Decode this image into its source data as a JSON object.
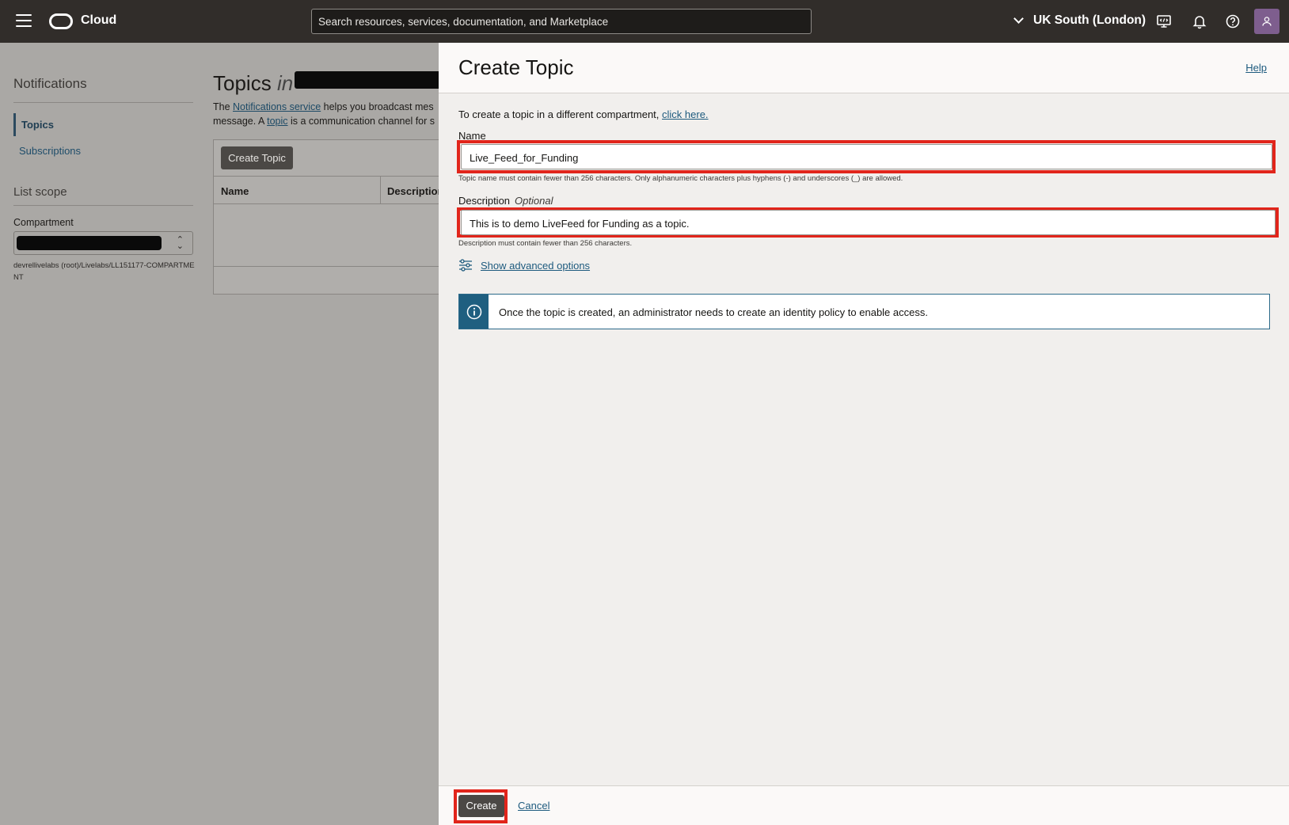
{
  "topbar": {
    "brand": "Cloud",
    "search_placeholder": "Search resources, services, documentation, and Marketplace",
    "region": "UK South (London)"
  },
  "background": {
    "nav_title": "Notifications",
    "nav_items": [
      "Topics",
      "Subscriptions"
    ],
    "scope_title": "List scope",
    "compartment_label": "Compartment",
    "compartment_path": "devrellivelabs (root)/Livelabs/LL151177-COMPARTMENT",
    "page_title_prefix": "Topics",
    "page_title_in": "in",
    "desc_line1_pre": "The ",
    "desc_link1": "Notifications service",
    "desc_line1_post": " helps you broadcast mes",
    "desc_line2_pre": "message. A ",
    "desc_link2": "topic",
    "desc_line2_post": " is a communication channel for s",
    "create_button": "Create Topic",
    "col_name": "Name",
    "col_description": "Description"
  },
  "drawer": {
    "title": "Create Topic",
    "help": "Help",
    "intro": "To create a topic in a different compartment, ",
    "intro_link": "click here.",
    "name_label": "Name",
    "name_value": "Live_Feed_for_Funding",
    "name_hint": "Topic name must contain fewer than 256 characters. Only alphanumeric characters plus hyphens (-) and underscores (_) are allowed.",
    "desc_label": "Description",
    "desc_optional": "Optional",
    "desc_value": "This is to demo LiveFeed for Funding as a topic.",
    "desc_hint": "Description must contain fewer than 256 characters.",
    "advanced": "Show advanced options",
    "info": "Once the topic is created, an administrator needs to create an identity policy to enable access.",
    "create": "Create",
    "cancel": "Cancel"
  },
  "colors": {
    "topbar": "#312d2a",
    "highlight": "#e1251b",
    "link": "#1d5a7e",
    "info_accent": "#1f5f80"
  }
}
